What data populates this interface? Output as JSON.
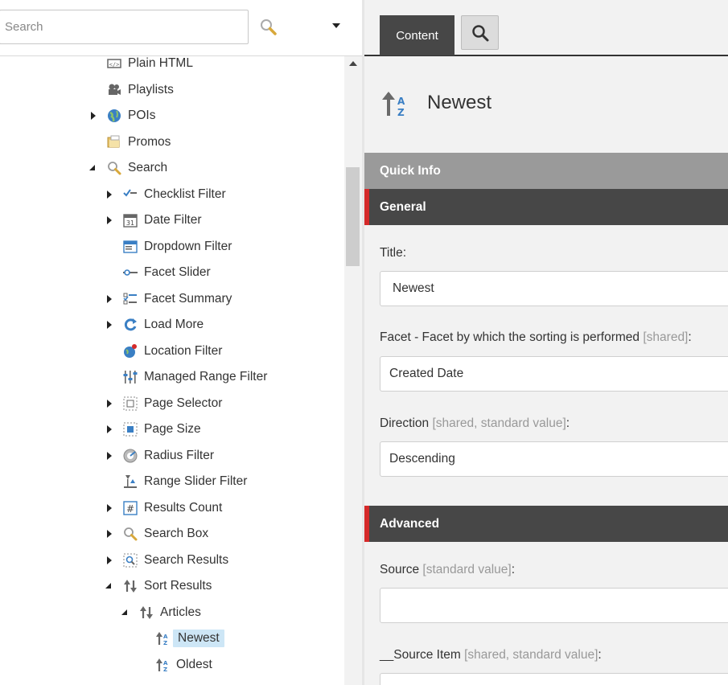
{
  "search": {
    "placeholder": "Search"
  },
  "tree": [
    {
      "label": "Plain HTML",
      "icon": "html-icon",
      "expander": "none",
      "selected": false
    },
    {
      "label": "Playlists",
      "icon": "film-camera-icon",
      "expander": "none",
      "selected": false
    },
    {
      "label": "POIs",
      "icon": "globe-icon",
      "expander": "closed",
      "selected": false
    },
    {
      "label": "Promos",
      "icon": "folder-icon",
      "expander": "none",
      "selected": false
    },
    {
      "label": "Search",
      "icon": "magnifier-icon",
      "expander": "open",
      "selected": false
    },
    {
      "label": "Checklist Filter",
      "icon": "checklist-icon",
      "expander": "closed",
      "selected": false
    },
    {
      "label": "Date Filter",
      "icon": "calendar-icon",
      "expander": "closed",
      "selected": false
    },
    {
      "label": "Dropdown Filter",
      "icon": "dropdown-icon",
      "expander": "none",
      "selected": false
    },
    {
      "label": "Facet Slider",
      "icon": "slider-icon",
      "expander": "none",
      "selected": false
    },
    {
      "label": "Facet Summary",
      "icon": "summary-list-icon",
      "expander": "closed",
      "selected": false
    },
    {
      "label": "Load More",
      "icon": "refresh-icon",
      "expander": "closed",
      "selected": false
    },
    {
      "label": "Location Filter",
      "icon": "globe-pin-icon",
      "expander": "none",
      "selected": false
    },
    {
      "label": "Managed Range Filter",
      "icon": "sliders-icon",
      "expander": "none",
      "selected": false
    },
    {
      "label": "Page Selector",
      "icon": "page-selector-icon",
      "expander": "closed",
      "selected": false
    },
    {
      "label": "Page Size",
      "icon": "page-size-icon",
      "expander": "closed",
      "selected": false
    },
    {
      "label": "Radius Filter",
      "icon": "radius-icon",
      "expander": "closed",
      "selected": false
    },
    {
      "label": "Range Slider Filter",
      "icon": "range-slider-icon",
      "expander": "none",
      "selected": false
    },
    {
      "label": "Results Count",
      "icon": "hash-icon",
      "expander": "closed",
      "selected": false
    },
    {
      "label": "Search Box",
      "icon": "magnifier-icon",
      "expander": "closed",
      "selected": false
    },
    {
      "label": "Search Results",
      "icon": "search-results-icon",
      "expander": "closed",
      "selected": false
    },
    {
      "label": "Sort Results",
      "icon": "sort-arrows-icon",
      "expander": "open",
      "selected": false
    },
    {
      "label": "Articles",
      "icon": "sort-arrows-icon",
      "expander": "open",
      "selected": false
    },
    {
      "label": "Newest",
      "icon": "sort-az-icon",
      "expander": "none",
      "selected": true
    },
    {
      "label": "Oldest",
      "icon": "sort-az-icon",
      "expander": "none",
      "selected": false
    }
  ],
  "editor": {
    "tabs": {
      "content": "Content"
    },
    "item_title": "Newest",
    "sections": {
      "quick_info": "Quick Info",
      "general": "General",
      "advanced": "Advanced"
    },
    "fields": {
      "title": {
        "label": "Title:",
        "meta": "",
        "value": "Newest"
      },
      "facet": {
        "label": "Facet - Facet by which the sorting is performed ",
        "meta": "[shared]",
        "suffix": ":",
        "value": "Created Date"
      },
      "direction": {
        "label": "Direction ",
        "meta": "[shared, standard value]",
        "suffix": ":",
        "value": "Descending"
      },
      "source": {
        "label": "Source ",
        "meta": "[standard value]",
        "suffix": ":",
        "value": ""
      },
      "source_item": {
        "label": "__Source Item ",
        "meta": "[shared, standard value]",
        "suffix": ":",
        "value": ""
      }
    }
  },
  "colors": {
    "accent_red": "#d52a2a",
    "section_dark": "#474747",
    "quick_info": "#9a9a9a",
    "selection": "#cde6f6",
    "icon_blue": "#3a7fc4"
  }
}
